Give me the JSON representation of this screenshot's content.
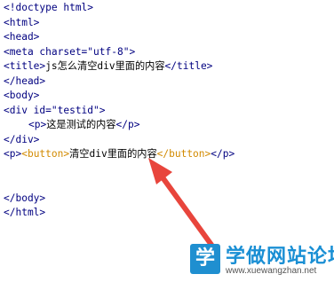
{
  "code": {
    "l1": "<!doctype html>",
    "l2": "<html>",
    "l3": "<head>",
    "l4": "<meta charset=\"utf-8\">",
    "l5_open": "<title>",
    "l5_text": "js怎么清空div里面的内容",
    "l5_close": "</title>",
    "l6": "</head>",
    "l7": "<body>",
    "l8": "<div id=\"testid\">",
    "l9_open": "<p>",
    "l9_text": "这是测试的内容",
    "l9_close": "</p>",
    "l10": "</div>",
    "l11_p_open": "<p>",
    "l11_btn_open": "<button>",
    "l11_text": "清空div里面的内容",
    "l11_btn_close": "</button>",
    "l11_p_close": "</p>",
    "l12": "",
    "l13": "",
    "l14": "</body>",
    "l15": "</html>"
  },
  "watermark": {
    "logo_char": "学",
    "title": "学做网站论坛",
    "url": "www.xuewangzhan.net"
  },
  "colors": {
    "tag": "#000080",
    "keyword": "#d28a00",
    "arrow": "#e8453c",
    "brand": "#1a8fd4"
  }
}
